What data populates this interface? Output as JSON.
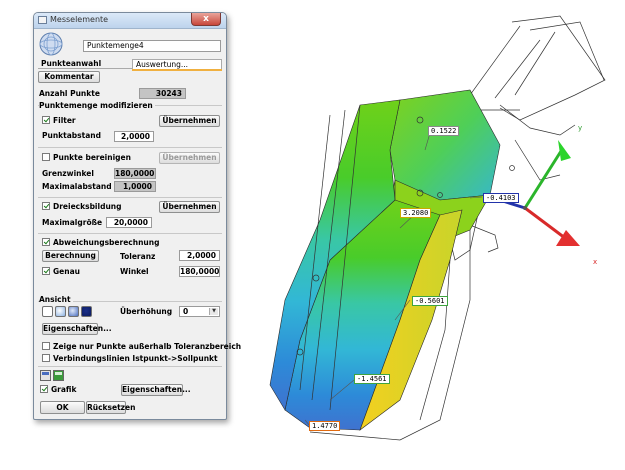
{
  "viewport": {
    "labels": {
      "l1": "0.1522",
      "l2": "-0.4103",
      "l3": "3.2080",
      "l4": "-0.5601",
      "l5": "-1.4561",
      "l6": "1.4770"
    },
    "axes": {
      "x": "x",
      "y": "y"
    }
  },
  "dialog": {
    "title": "Messelemente",
    "close_symbol": "x",
    "name_value": "Punktemenge4",
    "tabs": [
      "Punkteanwahl",
      "Auswertung..."
    ],
    "kommentar_label": "Kommentar",
    "anzahl_label": "Anzahl Punkte",
    "anzahl_value": "30243",
    "section_modify": "Punktemenge modifizieren",
    "filter_label": "Filter",
    "filter_apply": "Übernehmen",
    "punktabstand_label": "Punktabstand",
    "punktabstand_value": "2,0000",
    "bereinigen_label": "Punkte bereinigen",
    "bereinigen_apply": "Übernehmen",
    "grenzwinkel_label": "Grenzwinkel",
    "grenzwinkel_value": "180,0000",
    "maxabstand_label": "Maximalabstand",
    "maxabstand_value": "1,0000",
    "dreieck_label": "Dreiecksbildung",
    "dreieck_apply": "Übernehmen",
    "maxgroesse_label": "Maximalgröße",
    "maxgroesse_value": "20,0000",
    "abweichung_label": "Abweichungsberechnung",
    "berechnung_label": "Berechnung",
    "toleranz_label": "Toleranz",
    "toleranz_value": "2,0000",
    "genau_label": "Genau",
    "winkel_label": "Winkel",
    "winkel_value": "180,0000",
    "section_ansicht": "Ansicht",
    "ueberhoehung_label": "Überhöhung",
    "ueberhoehung_value": "0",
    "ueberhoehung_arrow": "▼",
    "eigenschaften_label": "Eigenschaften...",
    "zeige_label": "Zeige nur Punkte außerhalb Toleranzbereich",
    "verbindung_label": "Verbindungslinien Istpunkt->Sollpunkt",
    "grafik_label": "Grafik",
    "eigenschaften2_label": "Eigenschaften...",
    "ok_label": "OK",
    "ruecksetzen_label": "Rücksetzen"
  }
}
